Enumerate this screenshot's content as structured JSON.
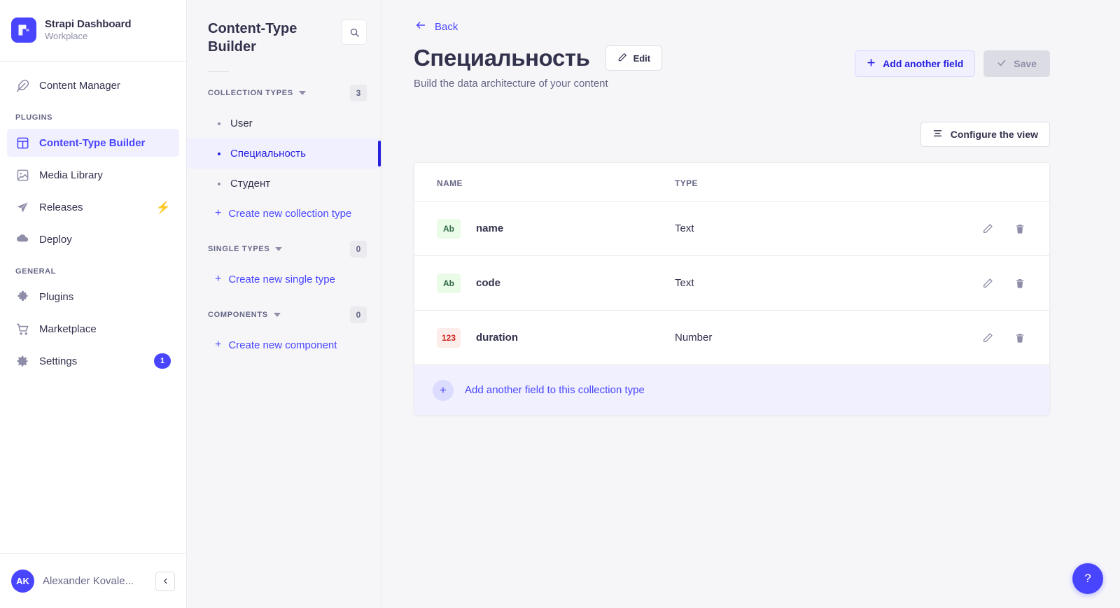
{
  "brand": {
    "title": "Strapi Dashboard",
    "subtitle": "Workplace",
    "logo_icon": "strapi-logo-icon",
    "logo_color": "#4945ff"
  },
  "nav": {
    "top_items": [
      {
        "label": "Content Manager",
        "icon": "feather-icon",
        "active": false
      }
    ],
    "sections": [
      {
        "label": "PLUGINS",
        "items": [
          {
            "label": "Content-Type Builder",
            "icon": "layout-icon",
            "active": true
          },
          {
            "label": "Media Library",
            "icon": "image-icon",
            "active": false
          },
          {
            "label": "Releases",
            "icon": "paper-plane-icon",
            "active": false,
            "accent": "bolt-icon"
          },
          {
            "label": "Deploy",
            "icon": "cloud-icon",
            "active": false
          }
        ]
      },
      {
        "label": "GENERAL",
        "items": [
          {
            "label": "Plugins",
            "icon": "puzzle-icon",
            "active": false
          },
          {
            "label": "Marketplace",
            "icon": "shopping-cart-icon",
            "active": false
          },
          {
            "label": "Settings",
            "icon": "gear-icon",
            "active": false,
            "badge": "1"
          }
        ]
      }
    ],
    "user": {
      "initials": "AK",
      "name": "Alexander Kovale...",
      "collapse_icon": "chevron-left-icon"
    }
  },
  "ctb": {
    "title": "Content-Type Builder",
    "search_icon": "search-icon",
    "groups": [
      {
        "label": "COLLECTION TYPES",
        "count": "3",
        "items": [
          {
            "label": "User",
            "selected": false
          },
          {
            "label": "Специальность",
            "selected": true
          },
          {
            "label": "Студент",
            "selected": false
          }
        ],
        "create_label": "Create new collection type"
      },
      {
        "label": "SINGLE TYPES",
        "count": "0",
        "items": [],
        "create_label": "Create new single type"
      },
      {
        "label": "COMPONENTS",
        "count": "0",
        "items": [],
        "create_label": "Create new component"
      }
    ]
  },
  "main": {
    "back_label": "Back",
    "back_icon": "arrow-left-icon",
    "title": "Специальность",
    "edit_label": "Edit",
    "edit_icon": "pencil-icon",
    "subtitle": "Build the data architecture of your content",
    "add_field_label": "Add another field",
    "add_field_icon": "plus-icon",
    "save_label": "Save",
    "save_icon": "check-icon",
    "save_disabled": true,
    "configure_label": "Configure the view",
    "configure_icon": "sliders-icon",
    "table": {
      "columns": [
        "NAME",
        "TYPE"
      ],
      "rows": [
        {
          "tag": "Ab",
          "tag_kind": "text",
          "name": "name",
          "type": "Text",
          "edit_icon": "pencil-icon",
          "delete_icon": "trash-icon"
        },
        {
          "tag": "Ab",
          "tag_kind": "text",
          "name": "code",
          "type": "Text",
          "edit_icon": "pencil-icon",
          "delete_icon": "trash-icon"
        },
        {
          "tag": "123",
          "tag_kind": "number",
          "name": "duration",
          "type": "Number",
          "edit_icon": "pencil-icon",
          "delete_icon": "trash-icon"
        }
      ],
      "footer_label": "Add another field to this collection type",
      "footer_icon": "plus-icon"
    },
    "help_label": "?",
    "help_icon": "question-mark-icon"
  },
  "colors": {
    "accent": "#4945ff",
    "accent_dark": "#271fe0",
    "accent_light": "#f0f0ff",
    "text": "#32324d",
    "muted": "#666687",
    "page_bg": "#f6f6f9",
    "tag_text_bg": "#eafbe7",
    "tag_text_fg": "#2f6846",
    "tag_number_bg": "#fcecea",
    "tag_number_fg": "#d02b20",
    "bolt": "#f29d41"
  }
}
